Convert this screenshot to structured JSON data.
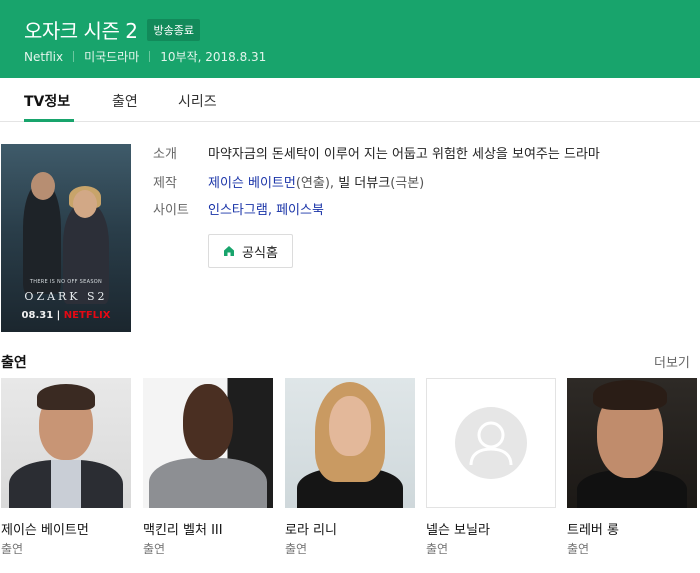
{
  "show": {
    "title": "오자크 시즌 2",
    "status_badge": "방송종료",
    "network": "Netflix",
    "genre": "미국드라마",
    "episodes_date": "10부작, 2018.8.31"
  },
  "tabs": [
    {
      "label": "TV정보",
      "active": true
    },
    {
      "label": "출연",
      "active": false
    },
    {
      "label": "시리즈",
      "active": false
    }
  ],
  "poster": {
    "tagline": "THERE IS NO OFF SEASON",
    "logo": "OZARK S2",
    "date": "08.31",
    "brand": "NETFLIX"
  },
  "info": {
    "intro_label": "소개",
    "intro_value": "마약자금의 돈세탁이 이루어 지는 어둡고 위험한 세상을 보여주는 드라마",
    "production_label": "제작",
    "director_name": "제이슨 베이트먼",
    "director_role": "(연출), ",
    "writer_name": "빌 더뷰크",
    "writer_role": "(극본)",
    "site_label": "사이트",
    "site_instagram": "인스타그램",
    "site_sep": ", ",
    "site_facebook": "페이스북",
    "home_button": "공식홈"
  },
  "cast_section": {
    "title": "출연",
    "more": "더보기",
    "members": [
      {
        "name": "제이슨 베이트먼",
        "role": "출연"
      },
      {
        "name": "맥킨리 벨처 III",
        "role": "출연"
      },
      {
        "name": "로라 리니",
        "role": "출연"
      },
      {
        "name": "넬슨 보닐라",
        "role": "출연"
      },
      {
        "name": "트레버 롱",
        "role": "출연"
      }
    ]
  },
  "colors": {
    "brand_green": "#18a46c",
    "link_blue": "#1a34a8",
    "netflix_red": "#e50914"
  }
}
